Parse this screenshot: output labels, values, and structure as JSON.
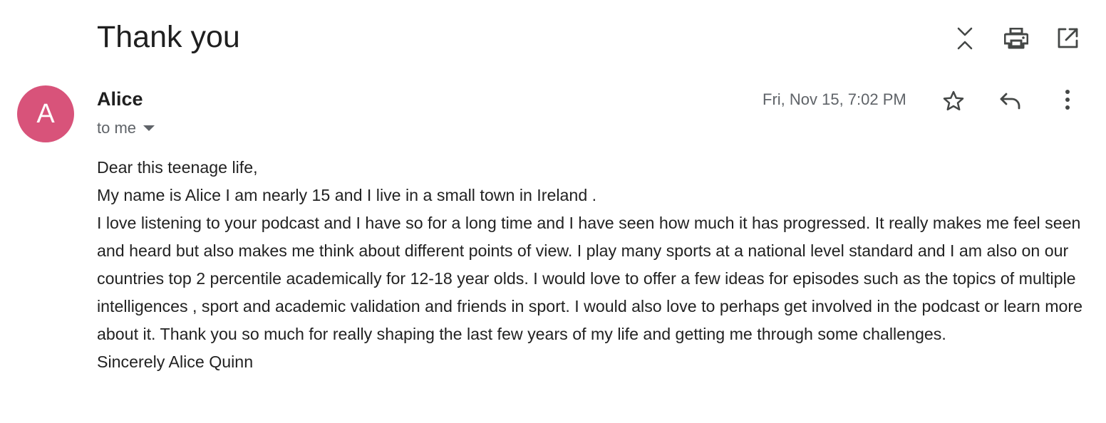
{
  "email": {
    "subject": "Thank you",
    "sender_name": "Alice",
    "avatar_letter": "A",
    "recipient": "to me",
    "date": "Fri, Nov 15, 7:02 PM",
    "body_lines": [
      "Dear this teenage life,",
      "My name is Alice I am nearly 15 and I live in a small town in Ireland .",
      "I love listening to your podcast and I have so for a long time and I have seen how much it has progressed. It really makes me feel seen and heard but also makes me think about different points of view. I play many sports at a national level standard and I am also on our countries top 2 percentile academically for 12-18 year olds. I would love to offer a few ideas for episodes such as the topics of multiple intelligences , sport and academic validation and friends in sport. I would also love to perhaps get involved in the podcast or learn more about it. Thank you so much for really shaping the last few years of my life and getting me through some challenges.",
      "Sincerely Alice Quinn"
    ]
  },
  "icons": {
    "collapse": "collapse-all-icon",
    "print": "print-icon",
    "open_new_window": "open-in-new-window-icon",
    "star": "star-icon",
    "reply": "reply-icon",
    "more": "more-vertical-icon",
    "recipient_dropdown": "chevron-down-icon"
  },
  "colors": {
    "avatar_bg": "#d8537a",
    "icon": "#444746",
    "secondary_text": "#5f6368"
  }
}
